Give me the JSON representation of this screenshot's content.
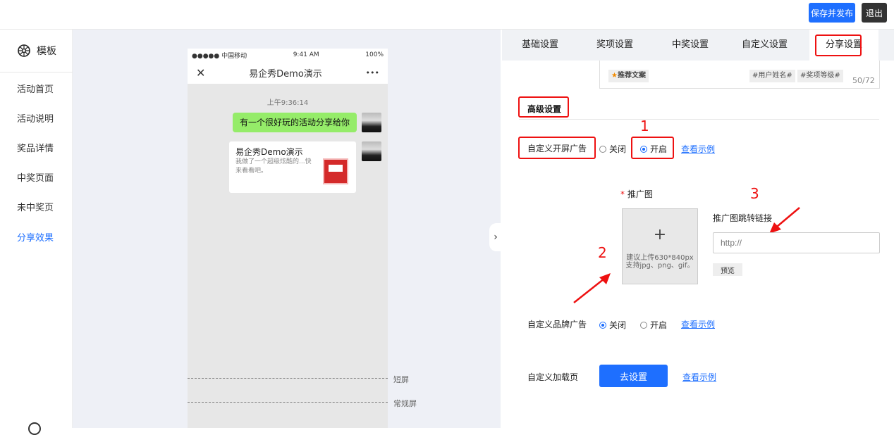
{
  "header": {
    "save_publish": "保存并发布",
    "exit": "退出"
  },
  "sidebar": {
    "template_label": "模板",
    "items": [
      {
        "label": "活动首页",
        "active": false
      },
      {
        "label": "活动说明",
        "active": false
      },
      {
        "label": "奖品详情",
        "active": false
      },
      {
        "label": "中奖页面",
        "active": false
      },
      {
        "label": "未中奖页",
        "active": false
      },
      {
        "label": "分享效果",
        "active": true
      }
    ]
  },
  "preview": {
    "status_carrier": "●●●●● 中国移动",
    "status_time": "9:41 AM",
    "status_battery": "100%",
    "nav_close": "✕",
    "nav_title": "易企秀Demo演示",
    "nav_more": "•••",
    "chat_time": "上午9:36:14",
    "message": "有一个很好玩的活动分享给你",
    "card_title": "易企秀Demo演示",
    "card_desc": "我做了一个超级炫酷的...快来看看吧。",
    "short_screen": "短屏",
    "normal_screen": "常规屏"
  },
  "tabs": [
    {
      "label": "基础设置",
      "active": false
    },
    {
      "label": "奖项设置",
      "active": false
    },
    {
      "label": "中奖设置",
      "active": false
    },
    {
      "label": "自定义设置",
      "active": false
    },
    {
      "label": "分享设置",
      "active": true
    }
  ],
  "share_text": {
    "chip_recommend": "推荐文案",
    "chip_username": "#用户姓名#",
    "chip_level": "#奖项等级#",
    "counter": "50/72"
  },
  "advanced": {
    "title": "高级设置",
    "splash_ad": {
      "label": "自定义开屏广告",
      "off": "关闭",
      "on": "开启",
      "selected": "on",
      "example": "查看示例"
    },
    "promo_image": {
      "required_mark": "*",
      "label": "推广图",
      "plus": "+",
      "hint": "建议上传630*840px 支持jpg、png、gif。"
    },
    "promo_link": {
      "label": "推广图跳转链接",
      "placeholder": "http://",
      "preview_button": "预览"
    },
    "brand_ad": {
      "label": "自定义品牌广告",
      "off": "关闭",
      "on": "开启",
      "selected": "off",
      "example": "查看示例"
    },
    "loading_page": {
      "label": "自定义加载页",
      "button": "去设置",
      "example": "查看示例"
    }
  },
  "annotations": {
    "one": "1",
    "two": "2",
    "three": "3"
  },
  "colors": {
    "accent": "#1e6fff",
    "annotation": "#ee1111",
    "chat_green": "#95ec69"
  }
}
